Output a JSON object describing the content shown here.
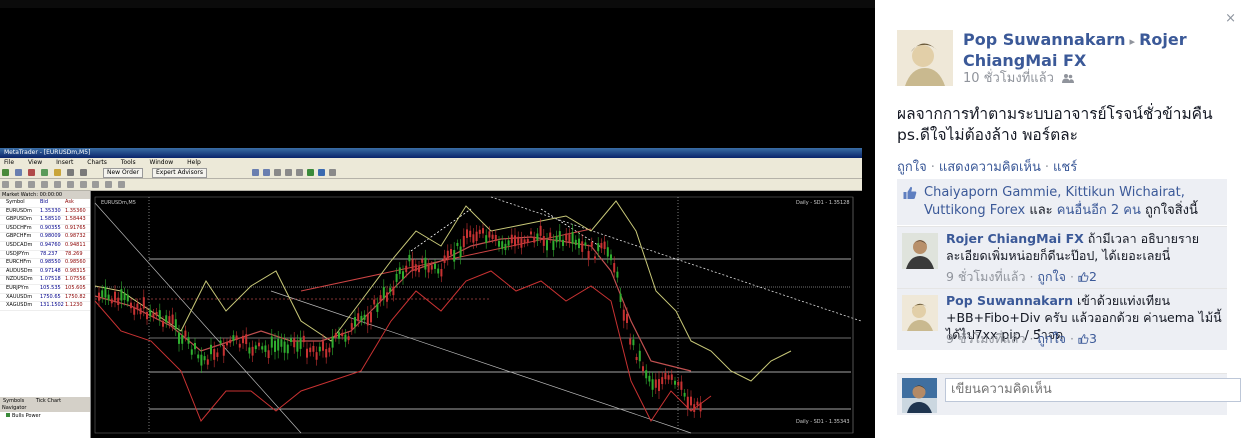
{
  "metatrader": {
    "title": "MetaTrader - [EURUSDm,M5]",
    "menu": [
      "File",
      "View",
      "Insert",
      "Charts",
      "Tools",
      "Window",
      "Help"
    ],
    "new_order_label": "New Order",
    "expert_advisors_label": "Expert Advisors",
    "market_watch_header": "Market Watch: 00:00:00",
    "market_watch_columns": [
      "Symbol",
      "Bid",
      "Ask"
    ],
    "market_watch_rows": [
      {
        "symbol": "EURUSDm",
        "bid": "1.35330",
        "ask": "1.35360"
      },
      {
        "symbol": "GBPUSDm",
        "bid": "1.58510",
        "ask": "1.58443"
      },
      {
        "symbol": "USDCHFm",
        "bid": "0.90355",
        "ask": "0.91765"
      },
      {
        "symbol": "GBPCHFm",
        "bid": "0.98009",
        "ask": "0.98732"
      },
      {
        "symbol": "USDCADm",
        "bid": "0.94760",
        "ask": "0.94811"
      },
      {
        "symbol": "USDJPYm",
        "bid": "78.237",
        "ask": "78.269"
      },
      {
        "symbol": "EURCHFm",
        "bid": "0.98550",
        "ask": "0.98560"
      },
      {
        "symbol": "AUDUSDm",
        "bid": "0.97148",
        "ask": "0.98315"
      },
      {
        "symbol": "NZDUSDm",
        "bid": "1.07518",
        "ask": "1.07556"
      },
      {
        "symbol": "EURJPYm",
        "bid": "105.535",
        "ask": "105.605"
      },
      {
        "symbol": "XAUUSDm",
        "bid": "1750.65",
        "ask": "1750.82"
      },
      {
        "symbol": "XAGUSDm",
        "bid": "131.1502",
        "ask": "1.1230"
      }
    ],
    "tabs": [
      "Symbols",
      "Tick Chart"
    ],
    "navigator_label": "Navigator",
    "navigator_item": "Bulls Power",
    "chart_label": "EURUSDm,M5",
    "chart_info": "Daily - SD1 - 1.35128",
    "chart_info_bottom": "Daily - SD1 - 1.35343"
  },
  "facebook": {
    "author": "Pop Suwannakarn",
    "arrow": "▸",
    "target": "Rojer ChiangMai FX",
    "time": "10 ชั่วโมงที่แล้ว",
    "audience_icon": "friends-icon",
    "post_text_line1": "ผลจากการทำตามระบบอาจารย์โรจน์ชั่วข้ามคืน",
    "post_text_line2": "ps.ดีใจไม่ต้องล้าง พอร์ตละ",
    "actions": [
      "ถูกใจ",
      "แสดงความคิดเห็น",
      "แชร์"
    ],
    "likes": {
      "names": "Chaiyaporn Gammie, Kittikun Wichairat, Vuttikong Forex",
      "middle": " และ ",
      "others": "คนอื่นอีก 2 คน",
      "suffix": " ถูกใจสิ่งนี้"
    },
    "comments": [
      {
        "name": "Rojer ChiangMai FX",
        "text": " ถ้ามีเวลา อธิบายรายละเอียดเพิ่มหน่อยก็ดีนะป๊อป, ได้เยอะเลยนี่",
        "time": "9 ชั่วโมงที่แล้ว",
        "like_label": "ถูกใจ",
        "like_count": "2"
      },
      {
        "name": "Pop Suwannakarn",
        "text": " เข้าด้วยแท่งเทียน +BB+Fibo+Div ครับ แล้วออกด้วย ค่านema ไม้นี้ได้ไป7xx pip / 5ำจด",
        "time": "9 ชั่วโมงที่แล้ว",
        "like_label": "ถูกใจ",
        "like_count": "3"
      }
    ],
    "write_placeholder": "เขียนความคิดเห็น",
    "close_symbol": "×",
    "separator": "·",
    "colors": {
      "link": "#3b5998",
      "muted": "#90949c",
      "panel": "#edeff4"
    }
  }
}
